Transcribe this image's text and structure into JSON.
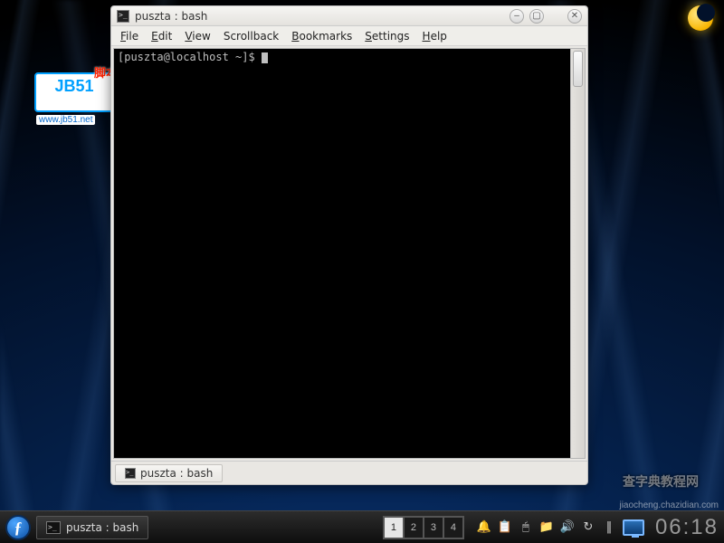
{
  "window": {
    "title": "puszta : bash",
    "buttons": {
      "min": "–",
      "max": "▢",
      "close": "✕"
    }
  },
  "menus": {
    "file": "File",
    "edit": "Edit",
    "view": "View",
    "scrollback": "Scrollback",
    "bookmarks": "Bookmarks",
    "settings": "Settings",
    "help": "Help"
  },
  "terminal": {
    "prompt": "[puszta@localhost ~]$ "
  },
  "tab": {
    "label": "puszta : bash"
  },
  "taskbar": {
    "task_label": "puszta : bash",
    "pager": [
      "1",
      "2",
      "3",
      "4"
    ],
    "active_pager": 0,
    "clock": "06:18"
  },
  "tray_icons": [
    "knotify",
    "klipper",
    "kmix",
    "folder",
    "volume",
    "network"
  ],
  "badges": {
    "jb51_text": "JB51",
    "jb51_cn": "脚本之家",
    "jb51_url": "www.jb51.net",
    "wm1": "查字典教程网",
    "wm2": "jiaocheng.chazidian.com"
  }
}
